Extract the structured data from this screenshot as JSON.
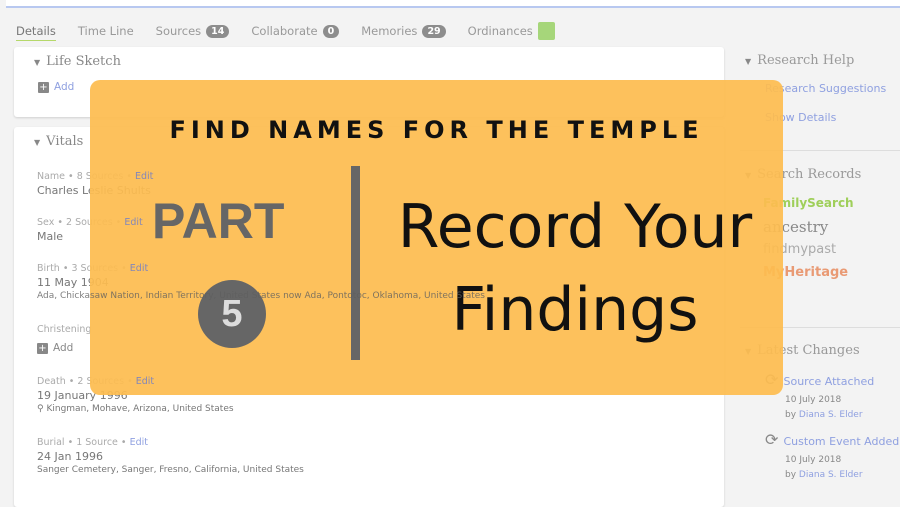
{
  "tabs": [
    {
      "label": "Details"
    },
    {
      "label": "Time Line"
    },
    {
      "label": "Sources",
      "count": "14"
    },
    {
      "label": "Collaborate",
      "count": "0"
    },
    {
      "label": "Memories",
      "count": "29"
    },
    {
      "label": "Ordinances"
    }
  ],
  "life_sketch": {
    "title": "Life Sketch",
    "add": "Add"
  },
  "vitals": {
    "title": "Vitals",
    "name": {
      "label": "Name",
      "sources": "8 Sources",
      "edit": "Edit",
      "value": "Charles Leslie Shults"
    },
    "sex": {
      "label": "Sex",
      "sources": "2 Sources",
      "edit": "Edit",
      "value": "Male"
    },
    "birth": {
      "label": "Birth",
      "sources": "3 Sources",
      "edit": "Edit",
      "value": "11 May 1904",
      "place": "Ada, Chickasaw Nation, Indian Territory, United States now Ada, Pontotoc, Oklahoma, United States"
    },
    "christening": {
      "label": "Christening",
      "add": "Add"
    },
    "death": {
      "label": "Death",
      "sources": "2 Sources",
      "edit": "Edit",
      "value": "19 January 1996",
      "place": "Kingman, Mohave, Arizona, United States"
    },
    "burial": {
      "label": "Burial",
      "sources": "1 Source",
      "edit": "Edit",
      "value": "24 Jan 1996",
      "place": "Sanger Cemetery, Sanger, Fresno, California, United States"
    }
  },
  "sidebar": {
    "research_help": "Research Help",
    "research_suggestions": "Research Suggestions",
    "show_details": "Show Details",
    "search_records": "Search Records",
    "providers": [
      "FamilySearch",
      "ancestry",
      "findmypast",
      "MyHeritage"
    ],
    "latest_changes": "Latest Changes",
    "changes": [
      {
        "title": "Source Attached",
        "date": "10 July 2018",
        "by": "by",
        "user": "Diana S. Elder"
      },
      {
        "title": "Custom Event Added",
        "date": "10 July 2018",
        "by": "by",
        "user": "Diana S. Elder"
      }
    ]
  },
  "banner": {
    "title": "FIND NAMES FOR THE TEMPLE",
    "part": "PART",
    "number": "5",
    "line1": "Record Your",
    "line2": "Findings",
    "color": "#FDBC50"
  }
}
